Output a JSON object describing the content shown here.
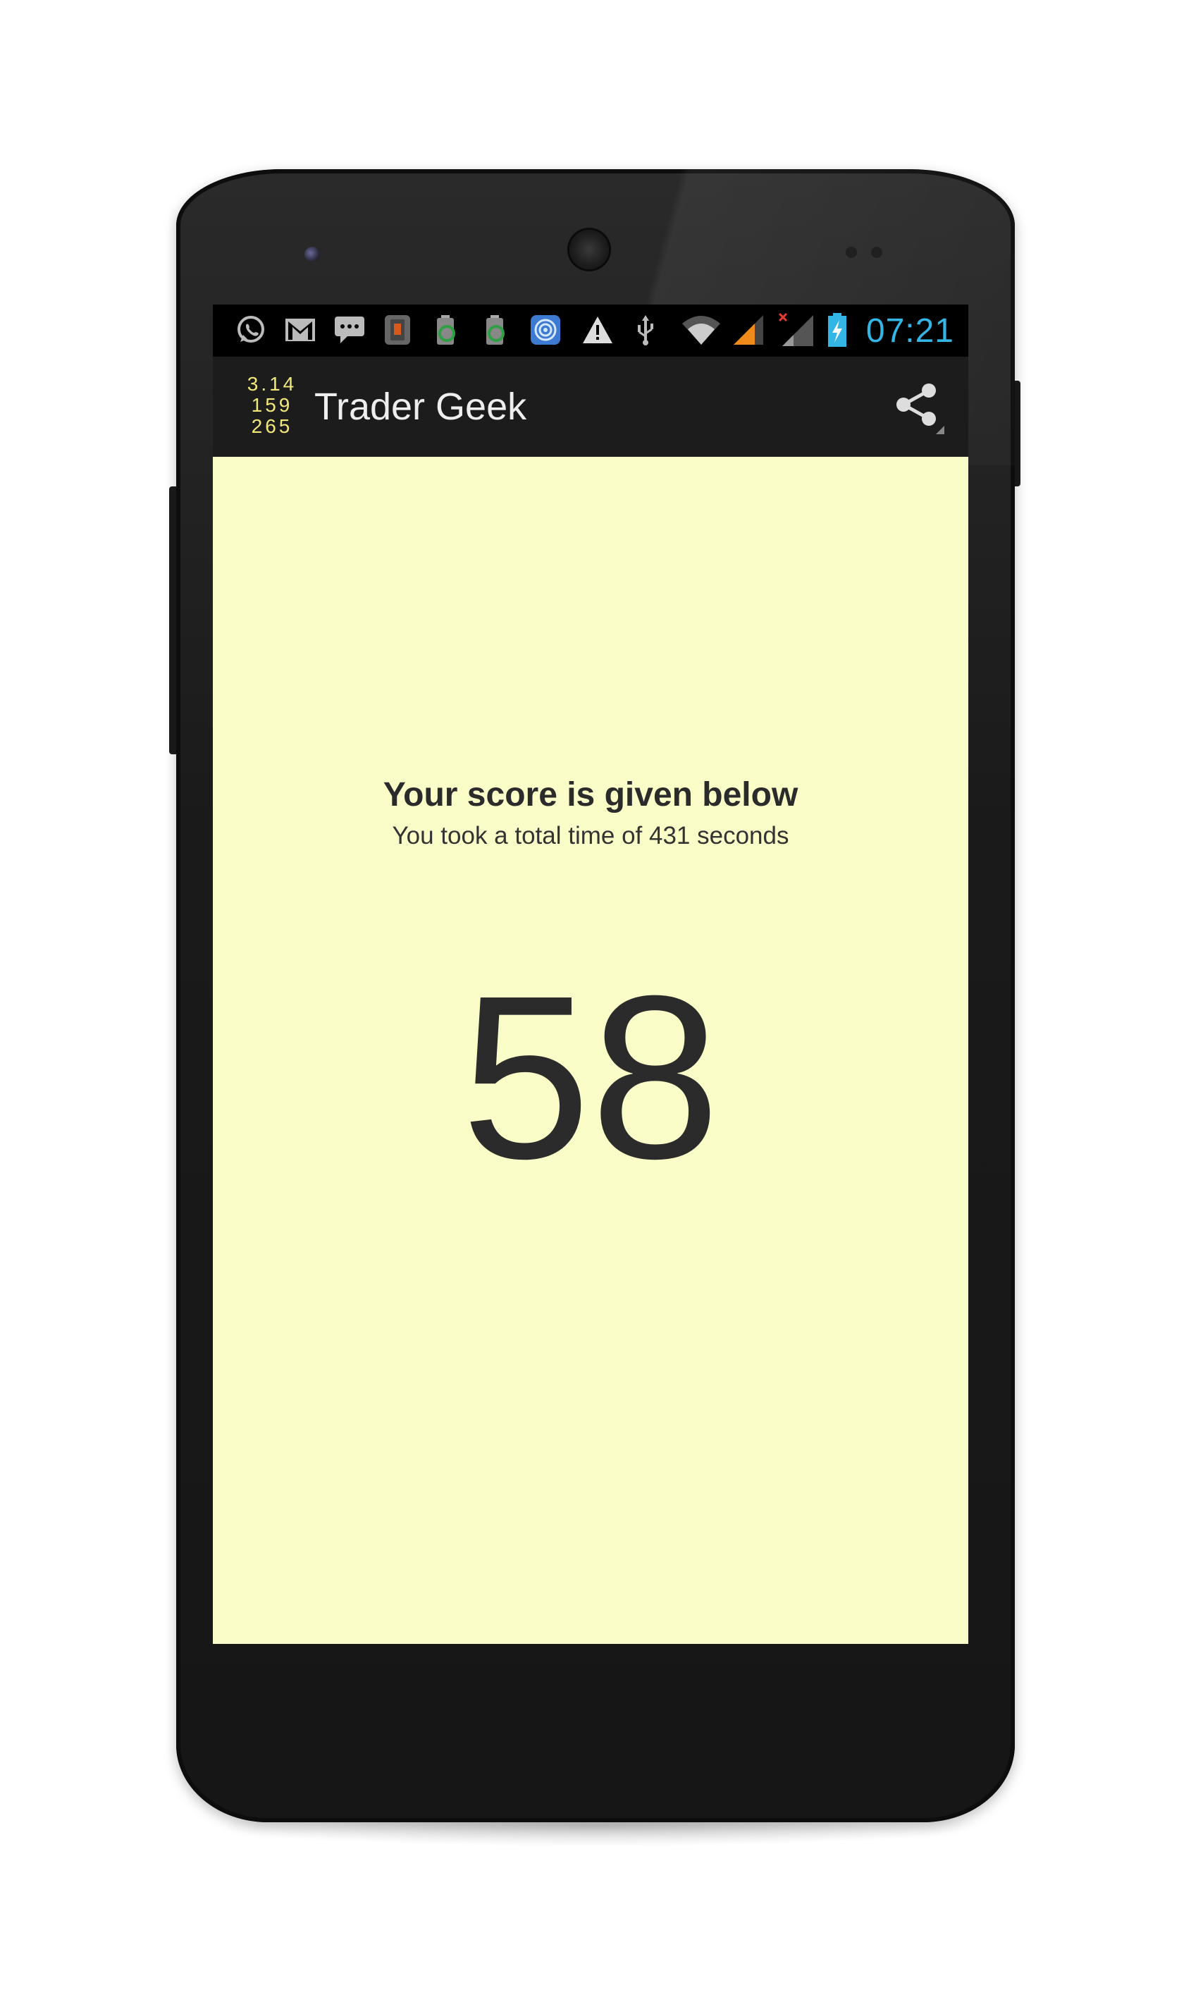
{
  "status_bar": {
    "time": "07:21",
    "time_color": "#33b5e5",
    "icons": [
      "whatsapp-icon",
      "gmail-icon",
      "sms-icon",
      "phone-app-icon",
      "battery-app-icon",
      "battery-app-icon-2",
      "target-app-icon",
      "warning-icon",
      "usb-icon",
      "wifi-icon",
      "signal-icon",
      "signal-no-service-icon",
      "battery-charging-icon"
    ]
  },
  "action_bar": {
    "logo_lines": [
      "3.14",
      "159",
      "265"
    ],
    "logo_color": "#f2e77a",
    "title": "Trader Geek",
    "share_icon": "share-icon"
  },
  "content": {
    "background": "#fbfdc8",
    "heading": "Your score is given below",
    "subheading": "You took a total time of 431 seconds",
    "score": "58"
  }
}
